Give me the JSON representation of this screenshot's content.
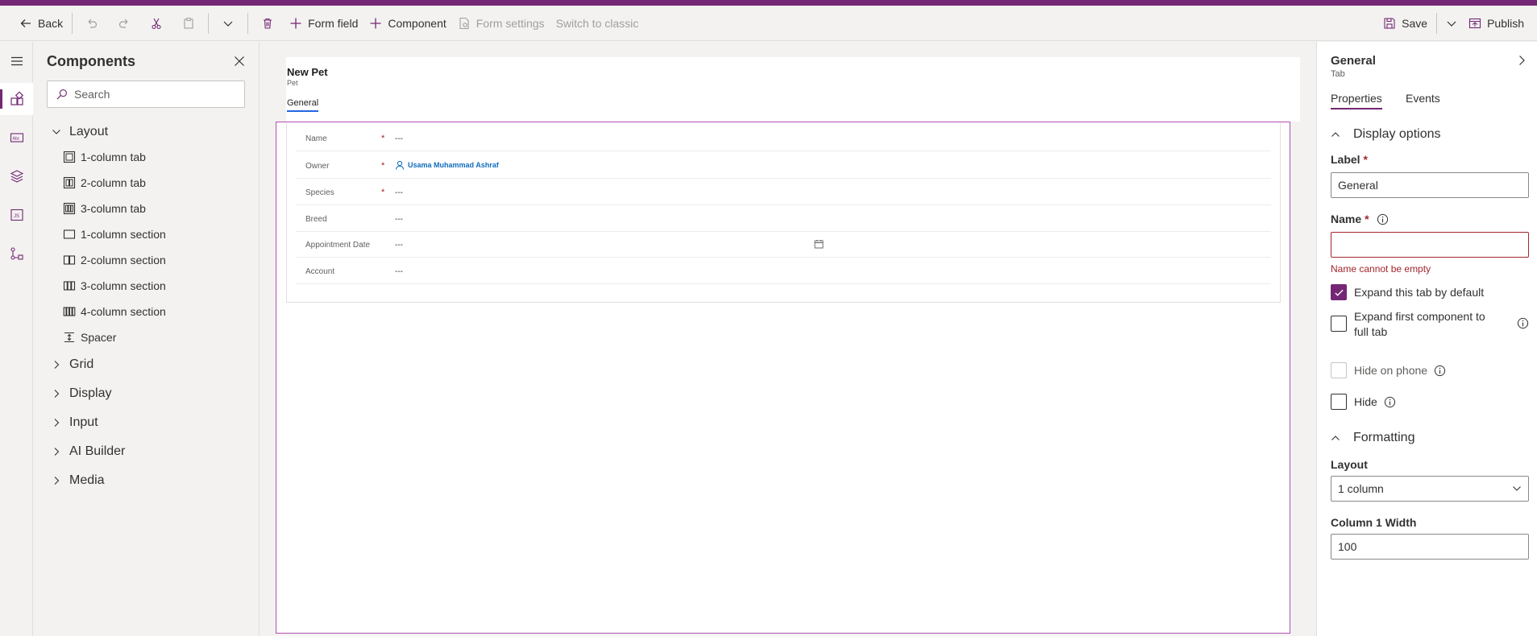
{
  "colors": {
    "brand": "#742774",
    "error": "#a4262c",
    "link": "#0f6cbd",
    "tab_underline": "#2266e3"
  },
  "commandbar": {
    "back": "Back",
    "form_field": "Form field",
    "component": "Component",
    "form_settings": "Form settings",
    "switch_to_classic": "Switch to classic",
    "save": "Save",
    "publish": "Publish"
  },
  "rail": {
    "items": [
      "hamburger-icon",
      "components-icon",
      "table-columns-icon",
      "tree-view-icon",
      "form-libraries-icon",
      "business-rules-icon"
    ]
  },
  "components": {
    "title": "Components",
    "search_placeholder": "Search",
    "layout_label": "Layout",
    "layout_items": [
      "1-column tab",
      "2-column tab",
      "3-column tab",
      "1-column section",
      "2-column section",
      "3-column section",
      "4-column section",
      "Spacer"
    ],
    "categories": [
      "Grid",
      "Display",
      "Input",
      "AI Builder",
      "Media"
    ]
  },
  "form": {
    "title": "New Pet",
    "entity": "Pet",
    "tab": "General",
    "fields": [
      {
        "label": "Name",
        "required": "*",
        "value": "---"
      },
      {
        "label": "Owner",
        "required": "*",
        "value": "Usama Muhammad Ashraf"
      },
      {
        "label": "Species",
        "required": "*",
        "value": "---"
      },
      {
        "label": "Breed",
        "required": "",
        "value": "---"
      },
      {
        "label": "Appointment Date",
        "required": "",
        "value": "---"
      },
      {
        "label": "Account",
        "required": "",
        "value": "---"
      }
    ]
  },
  "properties": {
    "title": "General",
    "subtitle": "Tab",
    "tabs": [
      "Properties",
      "Events"
    ],
    "display_options": "Display options",
    "label_label": "Label",
    "label_value": "General",
    "name_label": "Name",
    "name_value": "",
    "name_error": "Name cannot be empty",
    "checkboxes": [
      {
        "label": "Expand this tab by default",
        "checked": true
      },
      {
        "label": "Expand first component to full tab",
        "checked": false
      },
      {
        "label": "Hide on phone",
        "checked": false,
        "disabled": true
      },
      {
        "label": "Hide",
        "checked": false
      }
    ],
    "formatting": "Formatting",
    "layout_label": "Layout",
    "layout_value": "1 column",
    "column_width_label": "Column 1 Width",
    "column_width_value": "100",
    "required_mark": "*"
  }
}
